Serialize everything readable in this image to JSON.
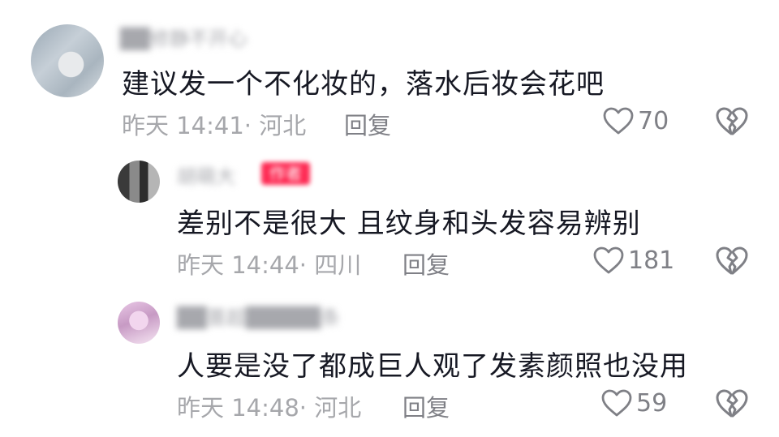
{
  "comments": [
    {
      "username": "██修静不开心",
      "text": "建议发一个不化妆的，落水后妆会花吧",
      "meta": "昨天 14:41· 河北",
      "reply_label": "回复",
      "likes": "70"
    },
    {
      "username": "胡萌大",
      "author_tag": "作者",
      "text": "差别不是很大 且纹身和头发容易辨别",
      "meta": "昨天 14:44· 四川",
      "reply_label": "回复",
      "likes": "181"
    },
    {
      "username": "██蔷超█████条",
      "text": "人要是没了都成巨人观了发素颜照也没用",
      "meta": "昨天 14:48· 河北",
      "reply_label": "回复",
      "likes": "59"
    }
  ],
  "icons": {
    "like": "heart-outline-icon",
    "dislike": "broken-heart-icon"
  },
  "colors": {
    "text": "#161823",
    "meta": "#a6a7ab",
    "action": "#7f8086",
    "author_tag": "#fe2c55"
  }
}
